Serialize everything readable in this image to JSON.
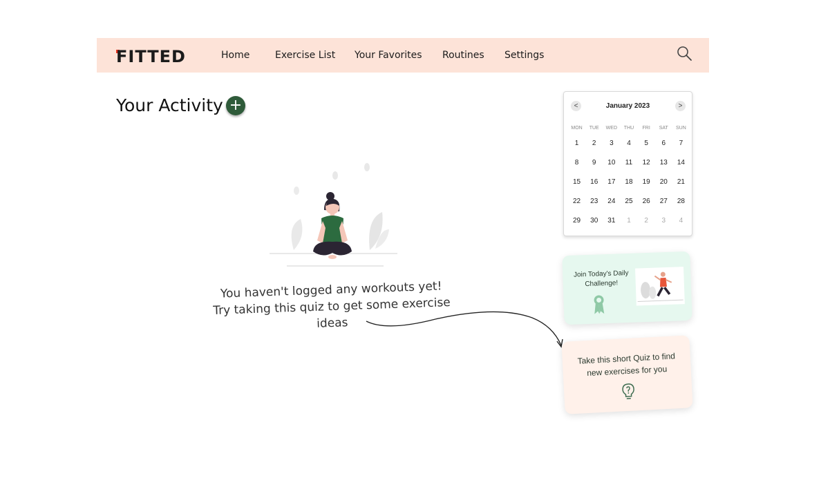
{
  "nav": {
    "logo": "FITTED",
    "items": [
      "Home",
      "Exercise List",
      "Your Favorites",
      "Routines",
      "Settings"
    ],
    "search_icon": "search-icon"
  },
  "activity": {
    "title": "Your Activity",
    "add_label": "+"
  },
  "empty_state": {
    "line1": "You haven't logged any workouts yet!",
    "line2": "Try taking this quiz to get some exercise ideas"
  },
  "calendar": {
    "month": "January 2023",
    "prev": "<",
    "next": ">",
    "weekdays": [
      "MON",
      "TUE",
      "WED",
      "THU",
      "FRI",
      "SAT",
      "SUN"
    ],
    "weeks": [
      [
        "1",
        "2",
        "3",
        "4",
        "5",
        "6",
        "7"
      ],
      [
        "8",
        "9",
        "10",
        "11",
        "12",
        "13",
        "14"
      ],
      [
        "15",
        "16",
        "17",
        "18",
        "19",
        "20",
        "21"
      ],
      [
        "22",
        "23",
        "24",
        "25",
        "26",
        "27",
        "28"
      ],
      [
        "29",
        "30",
        "31",
        "1",
        "2",
        "3",
        "4"
      ]
    ]
  },
  "challenge": {
    "text": "Join Today's Daily Challenge!"
  },
  "quiz": {
    "text": "Take this short Quiz to find new exercises for you"
  },
  "colors": {
    "nav_bg": "#fde3d8",
    "accent_green": "#2f5b3a",
    "challenge_bg": "#e6f8ef",
    "quiz_bg": "#fff1ea",
    "logo_accent": "#e8331f"
  }
}
